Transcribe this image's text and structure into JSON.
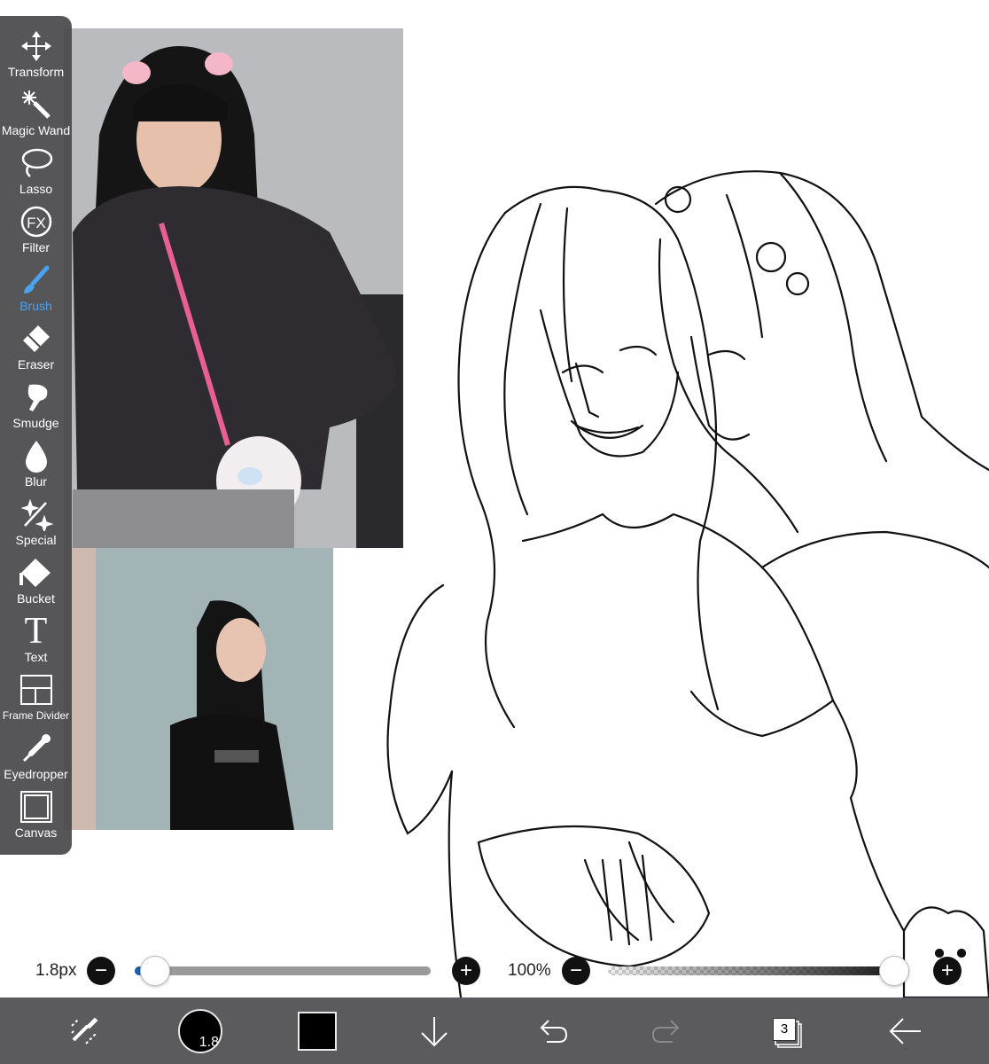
{
  "tools": [
    {
      "label": "Transform",
      "icon": "transform-icon"
    },
    {
      "label": "Magic Wand",
      "icon": "magic-wand-icon"
    },
    {
      "label": "Lasso",
      "icon": "lasso-icon"
    },
    {
      "label": "Filter",
      "icon": "filter-fx-icon",
      "icon_text": "FX"
    },
    {
      "label": "Brush",
      "icon": "brush-icon"
    },
    {
      "label": "Eraser",
      "icon": "eraser-icon"
    },
    {
      "label": "Smudge",
      "icon": "smudge-icon"
    },
    {
      "label": "Blur",
      "icon": "blur-drop-icon"
    },
    {
      "label": "Special",
      "icon": "special-sparkle-icon"
    },
    {
      "label": "Bucket",
      "icon": "bucket-icon"
    },
    {
      "label": "Text",
      "icon": "text-icon",
      "icon_text": "T"
    },
    {
      "label": "Frame Divider",
      "icon": "frame-divider-icon"
    },
    {
      "label": "Eyedropper",
      "icon": "eyedropper-icon"
    },
    {
      "label": "Canvas",
      "icon": "canvas-icon"
    }
  ],
  "active_tool": "Brush",
  "colors": {
    "active_tool": "#4aa3f0",
    "panel": "#48484a",
    "toolbar": "#5b5b5d",
    "size_fill": "#1e5ea8",
    "current_color": "#000000"
  },
  "sliders": {
    "size_label": "1.8px",
    "size_fraction": 0.02,
    "opacity_label": "100%",
    "opacity_fraction": 1.0,
    "minus_symbol": "−",
    "plus_symbol": "+"
  },
  "toolbar": {
    "brush_size": "1.8",
    "layer_count": "3",
    "icons": [
      "selection-transform-icon",
      "brush-size-icon",
      "color-swatch-icon",
      "download-arrow-icon",
      "undo-icon",
      "redo-icon",
      "layers-icon",
      "back-arrow-icon"
    ]
  }
}
